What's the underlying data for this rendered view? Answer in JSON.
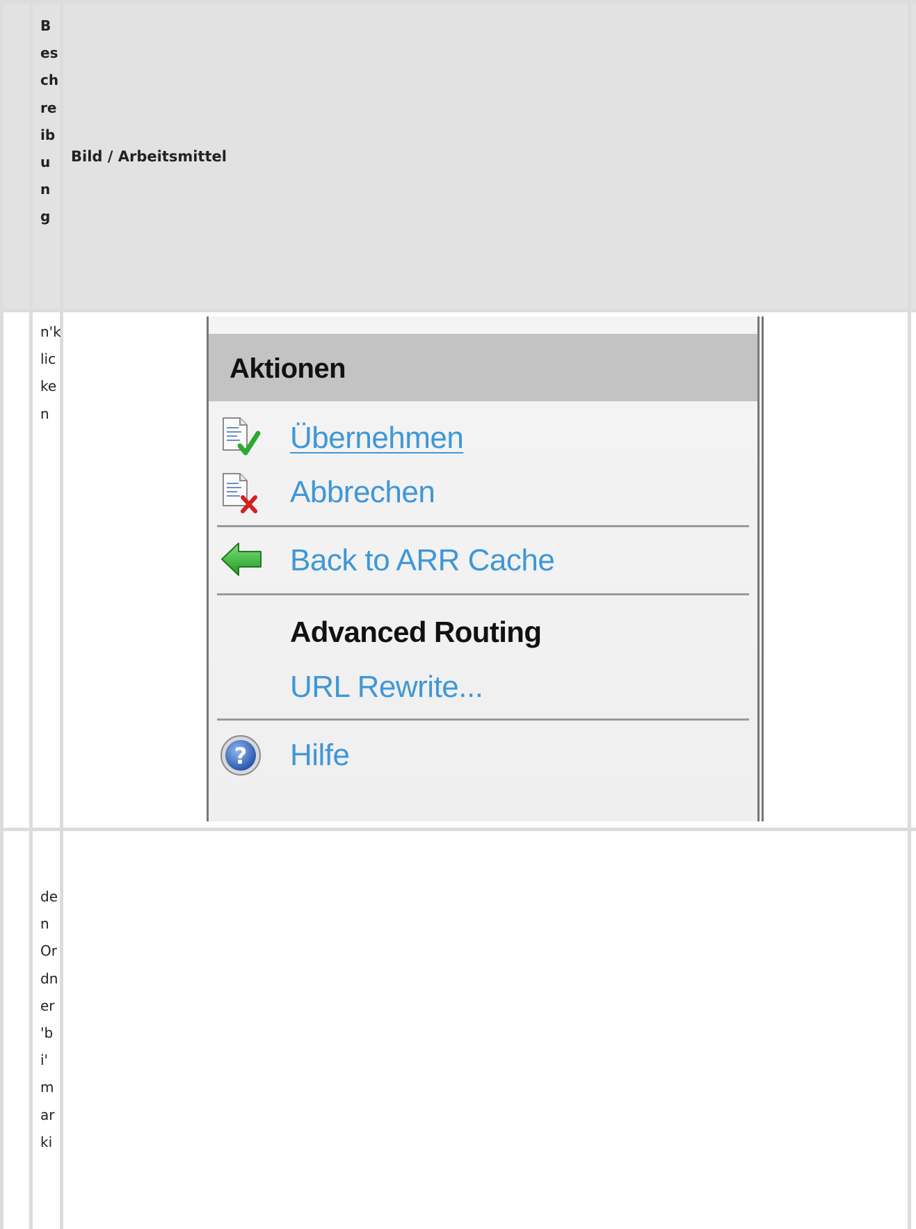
{
  "table": {
    "header": {
      "col_beschreibung": "Beschreibung",
      "col_bild": "Bild / Arbeitsmittel"
    },
    "rows": [
      {
        "beschreibung": "n'klicken"
      },
      {
        "beschreibung": "den Ordner 'bi' marki"
      }
    ]
  },
  "actions_panel": {
    "title": "Aktionen",
    "items": [
      {
        "label": "Übernehmen",
        "icon": "document-check-icon",
        "link": true
      },
      {
        "label": "Abbrechen",
        "icon": "document-cross-icon",
        "link": true
      },
      {
        "label": "Back to ARR Cache",
        "icon": "green-back-arrow-icon",
        "link": true
      }
    ],
    "section_title": "Advanced Routing",
    "section_items": [
      {
        "label": "URL Rewrite...",
        "link": true
      }
    ],
    "help": {
      "label": "Hilfe",
      "icon": "help-question-icon"
    }
  },
  "colors": {
    "link": "#3f97d6",
    "header_bar": "#c3c3c3",
    "table_header_bg": "#e2e2e2",
    "table_border": "#dcdcdc"
  }
}
